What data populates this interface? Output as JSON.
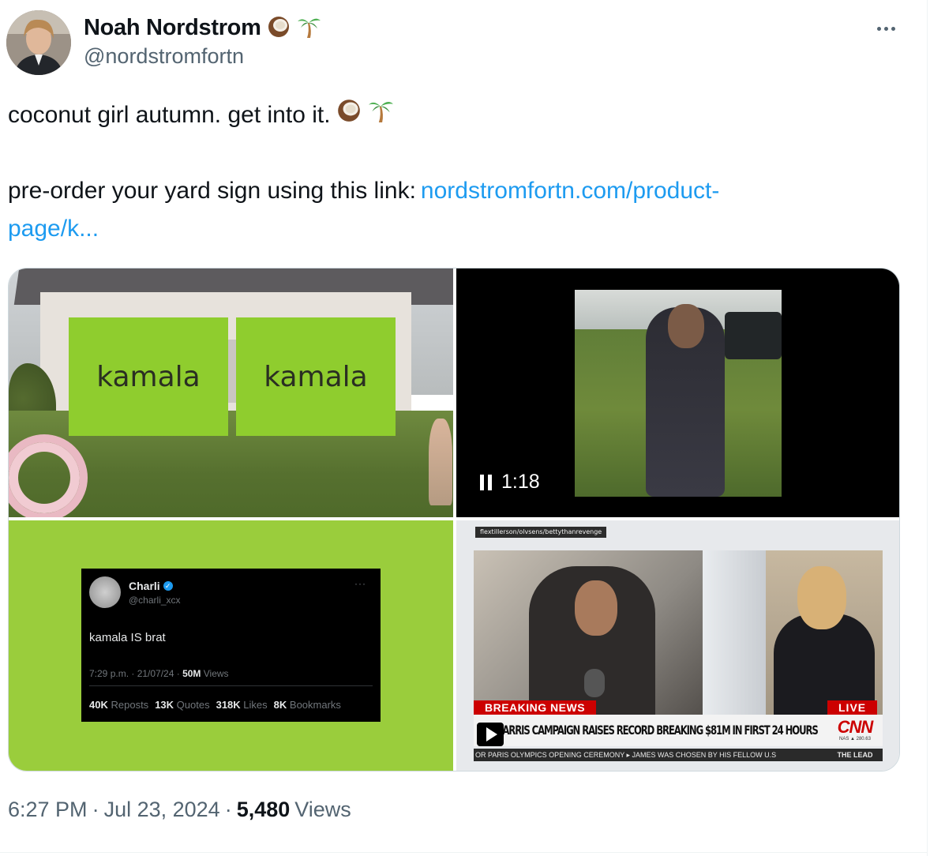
{
  "author": {
    "display_name": "Noah Nordstrom",
    "handle": "@nordstromfortn",
    "name_emojis": [
      "coconut-icon",
      "palm-tree-icon"
    ]
  },
  "tweet": {
    "line1": "coconut girl autumn. get into it.",
    "line2_prefix": "pre-order your yard sign using this link:",
    "link_part1": "nordstromfortn.com/product-",
    "link_part2": "page/k..."
  },
  "media": {
    "sign_left": "kamala",
    "sign_right": "kamala",
    "video_duration": "1:18",
    "embedded_tweet": {
      "name": "Charli",
      "handle": "@charli_xcx",
      "text": "kamala IS brat",
      "time": "7:29 p.m. · 21/07/24 ·",
      "views_count": "50M",
      "views_label": "Views",
      "reposts_count": "40K",
      "reposts_label": "Reposts",
      "quotes_count": "13K",
      "quotes_label": "Quotes",
      "likes_count": "318K",
      "likes_label": "Likes",
      "bookmarks_count": "8K",
      "bookmarks_label": "Bookmarks"
    },
    "news": {
      "source": "flextillerson/olvsens/bettythanrevenge",
      "breaking": "BREAKING NEWS",
      "live": "LIVE",
      "headline": "HARRIS CAMPAIGN RAISES RECORD BREAKING $81M IN FIRST 24 HOURS",
      "network": "CNN",
      "market": "NAS ▲ 280.63",
      "ticker": "OR PARIS OLYMPICS OPENING CEREMONY   ▸   JAMES WAS CHOSEN BY HIS FELLOW U.S",
      "show": "THE LEAD"
    }
  },
  "footer": {
    "time": "6:27 PM",
    "date": "Jul 23, 2024",
    "views_count": "5,480",
    "views_label": "Views"
  },
  "colors": {
    "link": "#1d9bf0",
    "sign_green": "#8fcd2e",
    "brat_green": "#9acd3c",
    "cnn_red": "#cc0000"
  }
}
